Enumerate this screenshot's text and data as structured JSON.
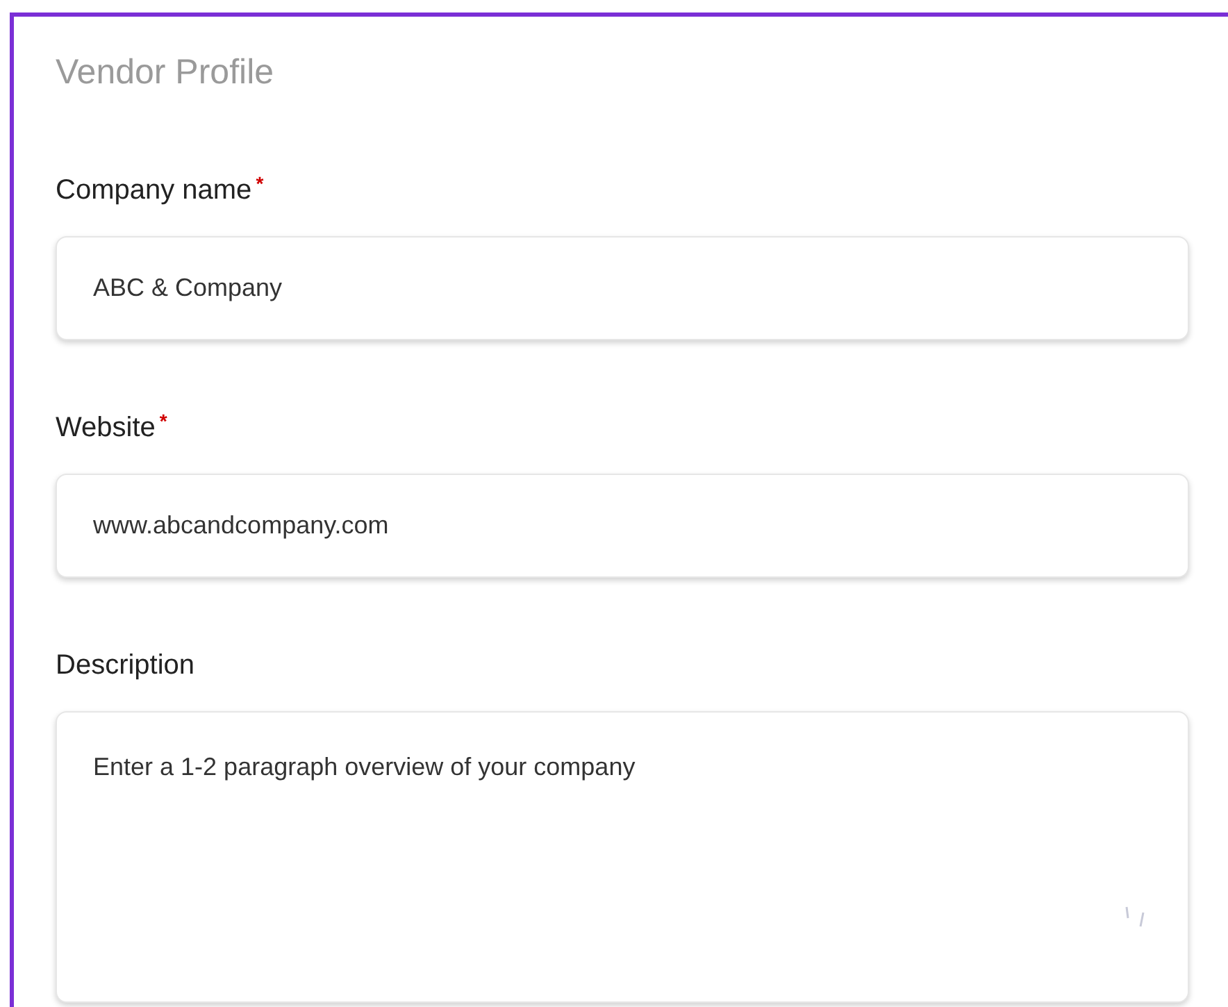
{
  "title": "Vendor Profile",
  "fields": [
    {
      "label": "Company name",
      "required_mark": "*",
      "kind": "input",
      "value": "ABC & Company"
    },
    {
      "label": "Website",
      "required_mark": "*",
      "kind": "input",
      "value": "www.abcandcompany.com"
    },
    {
      "label": "Description",
      "kind": "textarea",
      "placeholder": "Enter a 1-2 paragraph overview of your company"
    }
  ]
}
